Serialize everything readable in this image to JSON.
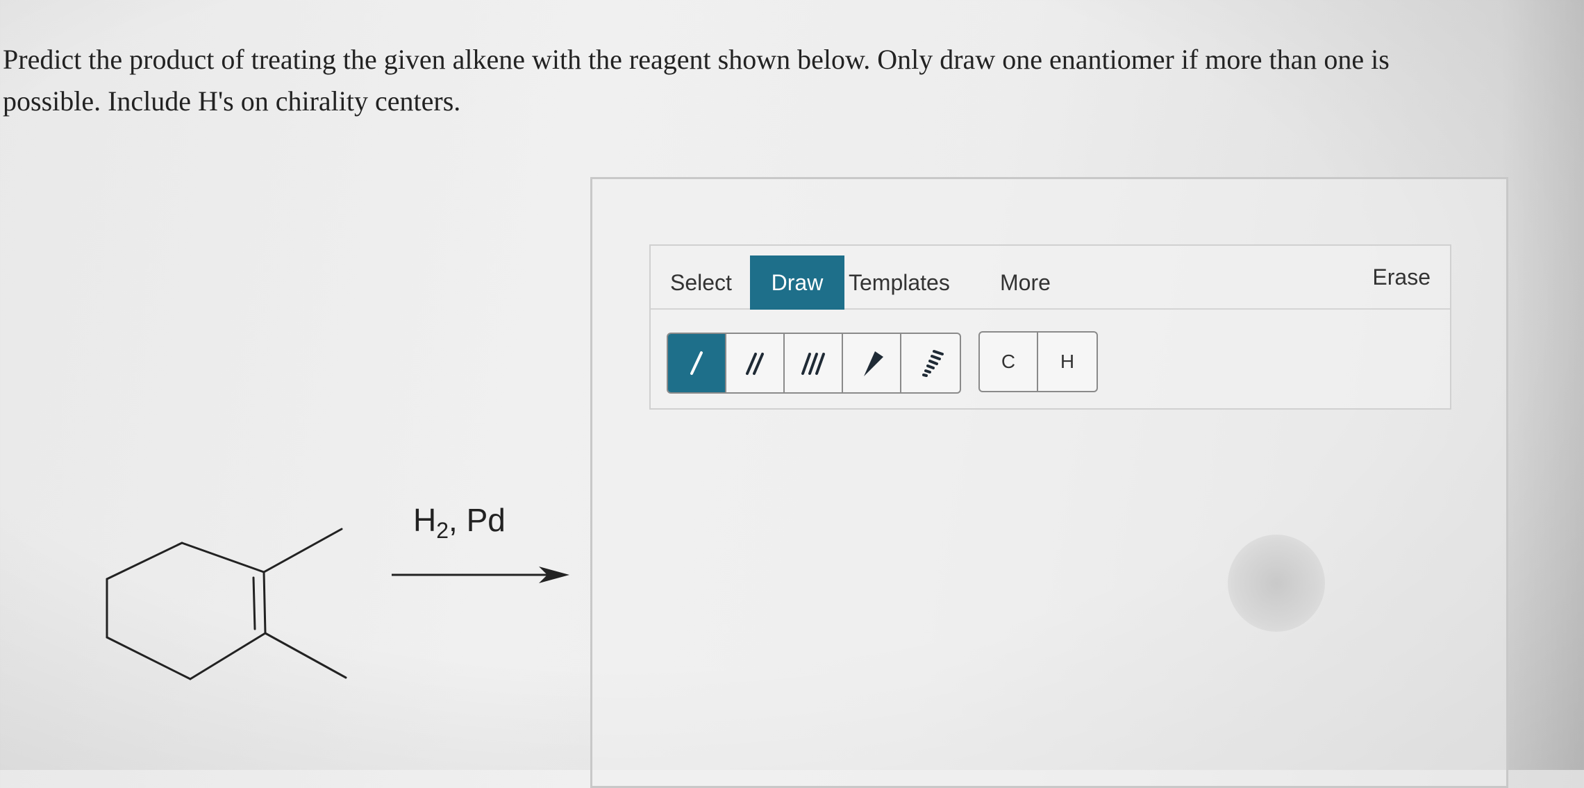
{
  "question": {
    "text": "Predict the product of treating the given alkene with the reagent shown below. Only draw one enantiomer if more than one is possible. Include H's on chirality centers."
  },
  "reaction": {
    "reagent_main": "H",
    "reagent_sub": "2",
    "reagent_rest": ", Pd"
  },
  "toolbar": {
    "tabs": [
      "Select",
      "Draw",
      "Templates",
      "More"
    ],
    "active_tab": "Draw",
    "erase_label": "Erase",
    "bond_tools": [
      "single-bond",
      "double-bond",
      "triple-bond",
      "wedge-bond",
      "hash-bond"
    ],
    "active_bond": "single-bond",
    "atoms": [
      "C",
      "H"
    ],
    "accent_color": "#1e6f8a"
  }
}
